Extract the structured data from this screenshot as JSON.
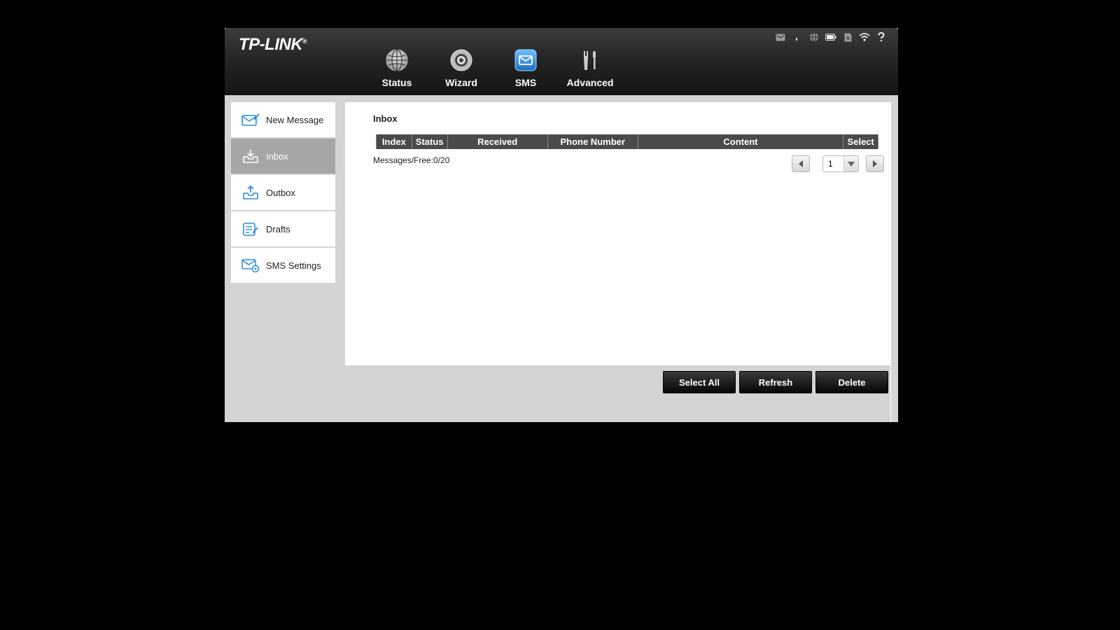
{
  "header": {
    "logo": "TP-LINK",
    "logo_mark": "®",
    "nav": [
      {
        "label": "Status",
        "icon": "globe-icon"
      },
      {
        "label": "Wizard",
        "icon": "gear-icon"
      },
      {
        "label": "SMS",
        "icon": "envelope-icon"
      },
      {
        "label": "Advanced",
        "icon": "tools-icon"
      }
    ],
    "active_nav": "SMS",
    "status_icons": [
      "message-status-icon",
      "signal-icon",
      "internet-globe-icon",
      "battery-icon",
      "sim-card-icon",
      "wifi-icon",
      "help-icon"
    ]
  },
  "sidebar": {
    "items": [
      {
        "label": "New Message",
        "icon": "new-message-icon"
      },
      {
        "label": "Inbox",
        "icon": "inbox-icon"
      },
      {
        "label": "Outbox",
        "icon": "outbox-icon"
      },
      {
        "label": "Drafts",
        "icon": "drafts-icon"
      },
      {
        "label": "SMS Settings",
        "icon": "sms-settings-icon"
      }
    ],
    "active": "Inbox"
  },
  "main": {
    "title": "Inbox",
    "columns": [
      "Index",
      "Status",
      "Received",
      "Phone Number",
      "Content",
      "Select"
    ],
    "rows": [],
    "count_text": "Messages/Free:0/20",
    "page": "1"
  },
  "actions": {
    "select_all": "Select All",
    "refresh": "Refresh",
    "delete": "Delete"
  },
  "colors": {
    "accent_blue": "#2f8fd8",
    "header_dark": "#1a1a1a",
    "panel_gray": "#d4d4d4",
    "active_sidebar": "#a6a6a6"
  }
}
